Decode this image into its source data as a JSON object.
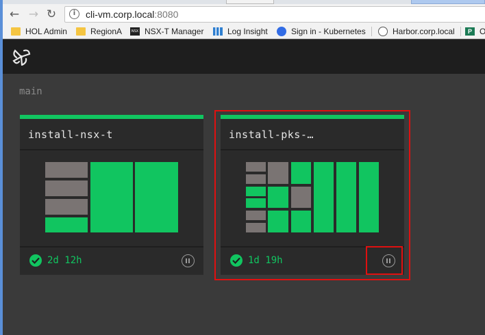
{
  "browser": {
    "address_host": "cli-vm.corp.local",
    "address_port": ":8080",
    "bookmarks": [
      {
        "label": "HOL Admin",
        "icon": "folder-icon"
      },
      {
        "label": "RegionA",
        "icon": "folder-icon"
      },
      {
        "label": "NSX-T Manager",
        "icon": "nsx-icon"
      },
      {
        "label": "Log Insight",
        "icon": "log-insight-icon"
      },
      {
        "label": "Sign in - Kubernetes",
        "icon": "kubernetes-icon"
      },
      {
        "label": "Harbor.corp.local",
        "icon": "harbor-icon"
      },
      {
        "label": "O",
        "icon": "p-icon"
      }
    ]
  },
  "app": {
    "group_name": "main",
    "pipelines": [
      {
        "name": "install-nsx-t",
        "status": "succeeded",
        "since": "2d 12h",
        "highlighted": false
      },
      {
        "name": "install-pks-…",
        "status": "succeeded",
        "since": "1d 19h",
        "highlighted": true
      }
    ]
  },
  "colors": {
    "succeeded": "#11c560",
    "pending": "#7a7473",
    "highlight": "#e01010"
  }
}
